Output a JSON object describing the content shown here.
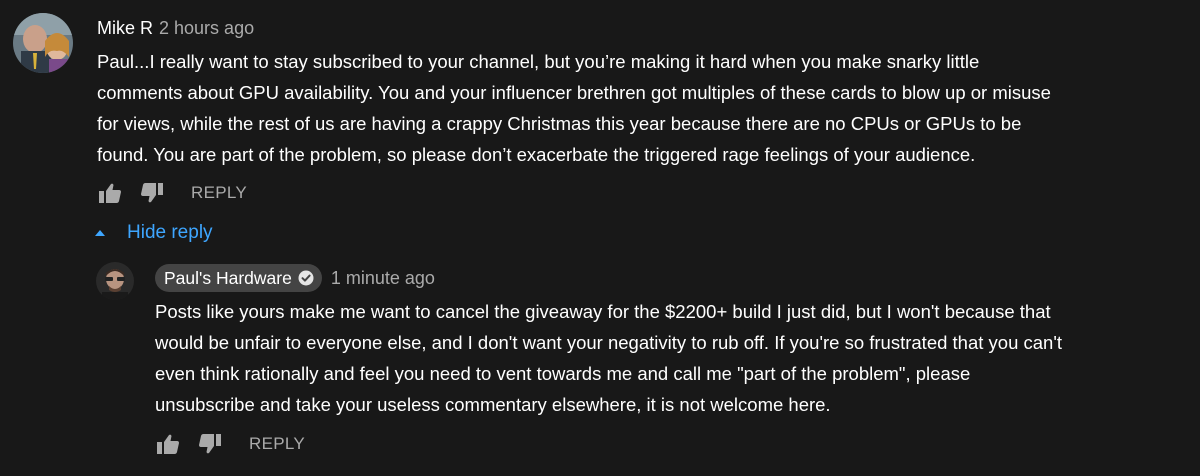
{
  "comment": {
    "author": "Mike R",
    "timestamp": "2 hours ago",
    "body": "Paul...I really want to stay subscribed to your channel, but you’re making it hard when you make snarky little\ncomments about GPU availability.  You and your influencer brethren got multiples of these cards to blow up or misuse\nfor views, while the rest of us are having a crappy Christmas this year because there are no CPUs or GPUs to be\nfound.  You are part of the problem, so please don’t exacerbate the triggered rage feelings of your audience.",
    "like_icon": "thumbs-up-icon",
    "dislike_icon": "thumbs-down-icon",
    "reply_label": "REPLY"
  },
  "hide_reply": {
    "label": "Hide reply",
    "icon": "caret-up-icon",
    "color": "#3ea6ff"
  },
  "reply": {
    "author": "Paul's Hardware",
    "verified_icon": "verified-check-icon",
    "timestamp": "1 minute ago",
    "body": "Posts like yours make me want to cancel the giveaway for the $2200+ build I just did, but I won't because that\nwould be unfair to everyone else, and I don't want your negativity to rub off. If you're so frustrated that you can't\neven think rationally and feel you need to vent towards me and call me \"part of the problem\", please\nunsubscribe and take your useless commentary elsewhere, it is not welcome here.",
    "like_icon": "thumbs-up-icon",
    "dislike_icon": "thumbs-down-icon",
    "reply_label": "REPLY"
  },
  "colors": {
    "background": "#181818",
    "text": "#ffffff",
    "secondary_text": "#aaaaaa",
    "badge_bg": "#444444"
  }
}
